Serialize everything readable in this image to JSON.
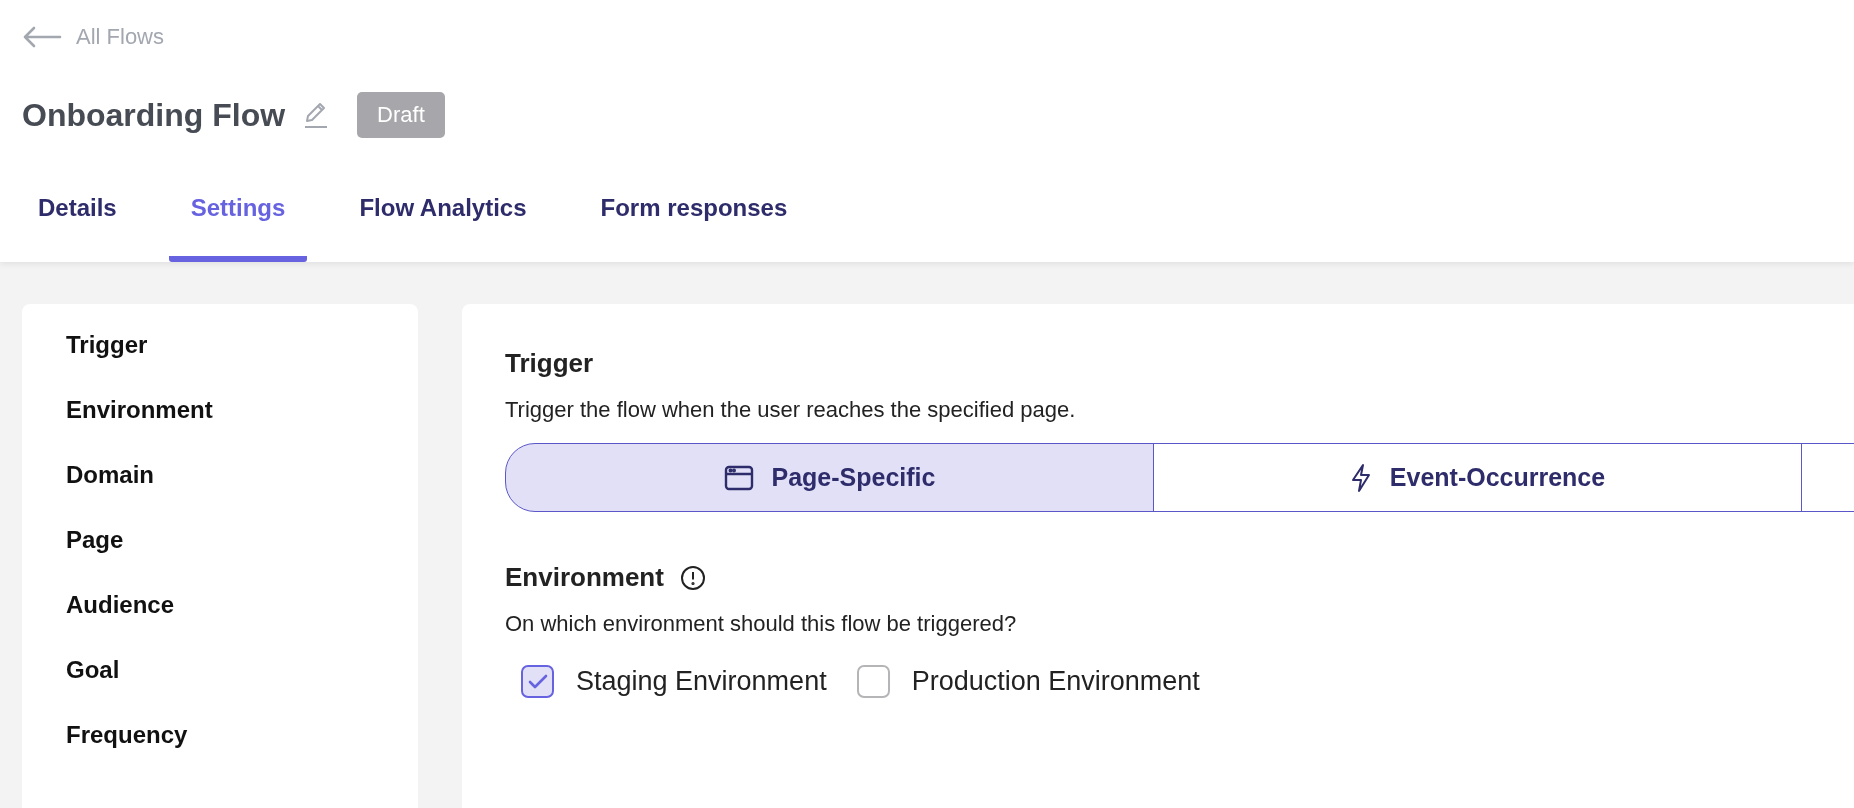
{
  "back_link": {
    "label": "All Flows"
  },
  "title": "Onboarding Flow",
  "status_badge": "Draft",
  "tabs": [
    {
      "label": "Details",
      "selected": false
    },
    {
      "label": "Settings",
      "selected": true
    },
    {
      "label": "Flow Analytics",
      "selected": false
    },
    {
      "label": "Form responses",
      "selected": false
    }
  ],
  "sidebar": {
    "items": [
      "Trigger",
      "Environment",
      "Domain",
      "Page",
      "Audience",
      "Goal",
      "Frequency"
    ]
  },
  "trigger": {
    "heading": "Trigger",
    "description": "Trigger the flow when the user reaches the specified page.",
    "options": [
      {
        "kind": "page",
        "label": "Page-Specific",
        "selected": true
      },
      {
        "kind": "event",
        "label": "Event-Occurrence",
        "selected": false
      }
    ]
  },
  "environment": {
    "heading": "Environment",
    "question": "On which environment should this flow be triggered?",
    "options": [
      {
        "label": "Staging Environment",
        "checked": true
      },
      {
        "label": "Production Environment",
        "checked": false
      }
    ]
  }
}
